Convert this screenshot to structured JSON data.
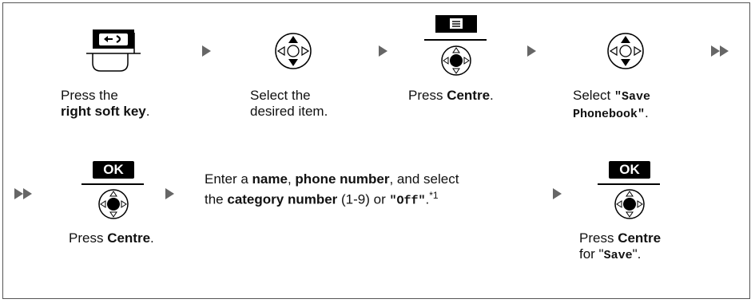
{
  "steps_row1": [
    {
      "pre": "Press the",
      "bold": "right soft key",
      "post": "."
    },
    {
      "line1": "Select the",
      "line2": "desired item."
    },
    {
      "pre": "Press ",
      "bold": "Centre",
      "post": "."
    },
    {
      "pre": "Select ",
      "mono1": "\"Save",
      "mono2": "Phonebook\"",
      "post": "."
    }
  ],
  "steps_row2": [
    {
      "pre": "Press ",
      "bold": "Centre",
      "post": "."
    },
    {
      "t1": "Enter a ",
      "b1": "name",
      "t2": ", ",
      "b2": "phone number",
      "t3": ", and select",
      "t4": "the ",
      "b3": "category number",
      "t5": " (1-9) or ",
      "mono": "\"Off\"",
      "t6": ".",
      "sup": "*1"
    },
    {
      "pre": "Press ",
      "bold": "Centre",
      "line2_pre": "for \"",
      "mono": "Save",
      "line2_post": "\"."
    }
  ],
  "keys": {
    "ok1": "OK",
    "ok2": "OK"
  },
  "icons": {
    "soft_key": "right-soft-key-icon",
    "nav": "navigator-key-icon",
    "menu": "menu-key-icon",
    "centre": "centre-key-icon"
  }
}
